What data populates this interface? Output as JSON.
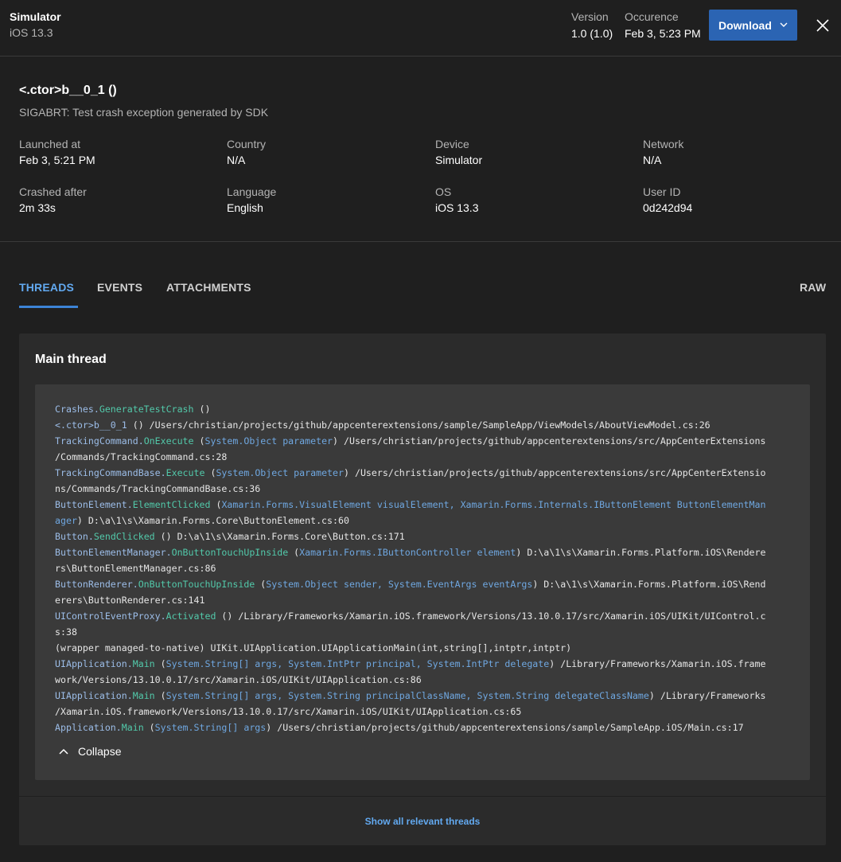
{
  "header": {
    "device_name": "Simulator",
    "device_os": "iOS 13.3",
    "version_label": "Version",
    "version_value": "1.0 (1.0)",
    "occurrence_label": "Occurence",
    "occurrence_value": "Feb 3, 5:23 PM",
    "download_label": "Download"
  },
  "crash": {
    "title": "<.ctor>b__0_1 ()",
    "reason": "SIGABRT: Test crash exception generated by SDK"
  },
  "details": {
    "launched_at_label": "Launched at",
    "launched_at_value": "Feb 3, 5:21 PM",
    "country_label": "Country",
    "country_value": "N/A",
    "device_label": "Device",
    "device_value": "Simulator",
    "network_label": "Network",
    "network_value": "N/A",
    "crashed_after_label": "Crashed after",
    "crashed_after_value": "2m 33s",
    "language_label": "Language",
    "language_value": "English",
    "os_label": "OS",
    "os_value": "iOS 13.3",
    "user_id_label": "User ID",
    "user_id_value": "0d242d94"
  },
  "tabs": {
    "threads": "THREADS",
    "events": "EVENTS",
    "attachments": "ATTACHMENTS",
    "raw": "RAW"
  },
  "thread": {
    "title": "Main thread",
    "collapse_label": "Collapse",
    "show_all_label": "Show all relevant threads",
    "lines": [
      [
        [
          "cls",
          "Crashes."
        ],
        [
          "mth",
          "GenerateTestCrash"
        ],
        [
          "txt",
          " ()"
        ]
      ],
      [
        [
          "cls",
          "<.ctor>b__0_1"
        ],
        [
          "txt",
          " () /Users/christian/projects/github/appcenterextensions/sample/SampleApp/ViewModels/AboutViewModel.cs:26"
        ]
      ],
      [
        [
          "cls",
          "TrackingCommand."
        ],
        [
          "mth",
          "OnExecute"
        ],
        [
          "txt",
          " ("
        ],
        [
          "par",
          "System.Object parameter"
        ],
        [
          "txt",
          ") /Users/christian/projects/github/appcenterextensions/src/AppCenterExtensions"
        ]
      ],
      [
        [
          "txt",
          "/Commands/TrackingCommand.cs:28"
        ]
      ],
      [
        [
          "cls",
          "TrackingCommandBase."
        ],
        [
          "mth",
          "Execute"
        ],
        [
          "txt",
          " ("
        ],
        [
          "par",
          "System.Object parameter"
        ],
        [
          "txt",
          ") /Users/christian/projects/github/appcenterextensions/src/AppCenterExtensio"
        ]
      ],
      [
        [
          "txt",
          "ns/Commands/TrackingCommandBase.cs:36"
        ]
      ],
      [
        [
          "cls",
          "ButtonElement."
        ],
        [
          "mth",
          "ElementClicked"
        ],
        [
          "txt",
          " ("
        ],
        [
          "par",
          "Xamarin.Forms.VisualElement visualElement, Xamarin.Forms.Internals.IButtonElement ButtonElementMan"
        ]
      ],
      [
        [
          "par",
          "ager"
        ],
        [
          "txt",
          ") D:\\a\\1\\s\\Xamarin.Forms.Core\\ButtonElement.cs:60"
        ]
      ],
      [
        [
          "cls",
          "Button."
        ],
        [
          "mth",
          "SendClicked"
        ],
        [
          "txt",
          " () D:\\a\\1\\s\\Xamarin.Forms.Core\\Button.cs:171"
        ]
      ],
      [
        [
          "cls",
          "ButtonElementManager."
        ],
        [
          "mth",
          "OnButtonTouchUpInside"
        ],
        [
          "txt",
          " ("
        ],
        [
          "par",
          "Xamarin.Forms.IButtonController element"
        ],
        [
          "txt",
          ") D:\\a\\1\\s\\Xamarin.Forms.Platform.iOS\\Rendere"
        ]
      ],
      [
        [
          "txt",
          "rs\\ButtonElementManager.cs:86"
        ]
      ],
      [
        [
          "cls",
          "ButtonRenderer."
        ],
        [
          "mth",
          "OnButtonTouchUpInside"
        ],
        [
          "txt",
          " ("
        ],
        [
          "par",
          "System.Object sender, System.EventArgs eventArgs"
        ],
        [
          "txt",
          ") D:\\a\\1\\s\\Xamarin.Forms.Platform.iOS\\Rend"
        ]
      ],
      [
        [
          "txt",
          "erers\\ButtonRenderer.cs:141"
        ]
      ],
      [
        [
          "cls",
          "UIControlEventProxy."
        ],
        [
          "mth",
          "Activated"
        ],
        [
          "txt",
          " () /Library/Frameworks/Xamarin.iOS.framework/Versions/13.10.0.17/src/Xamarin.iOS/UIKit/UIControl.c"
        ]
      ],
      [
        [
          "txt",
          "s:38"
        ]
      ],
      [
        [
          "txt",
          "(wrapper managed-to-native) UIKit.UIApplication.UIApplicationMain(int,string[],intptr,intptr)"
        ]
      ],
      [
        [
          "cls",
          "UIApplication."
        ],
        [
          "mth",
          "Main"
        ],
        [
          "txt",
          " ("
        ],
        [
          "par",
          "System.String[] args, System.IntPtr principal, System.IntPtr delegate"
        ],
        [
          "txt",
          ") /Library/Frameworks/Xamarin.iOS.frame"
        ]
      ],
      [
        [
          "txt",
          "work/Versions/13.10.0.17/src/Xamarin.iOS/UIKit/UIApplication.cs:86"
        ]
      ],
      [
        [
          "cls",
          "UIApplication."
        ],
        [
          "mth",
          "Main"
        ],
        [
          "txt",
          " ("
        ],
        [
          "par",
          "System.String[] args, System.String principalClassName, System.String delegateClassName"
        ],
        [
          "txt",
          ") /Library/Frameworks"
        ]
      ],
      [
        [
          "txt",
          "/Xamarin.iOS.framework/Versions/13.10.0.17/src/Xamarin.iOS/UIKit/UIApplication.cs:65"
        ]
      ],
      [
        [
          "cls",
          "Application."
        ],
        [
          "mth",
          "Main"
        ],
        [
          "txt",
          " ("
        ],
        [
          "par",
          "System.String[] args"
        ],
        [
          "txt",
          ") /Users/christian/projects/github/appcenterextensions/sample/SampleApp.iOS/Main.cs:17"
        ]
      ]
    ]
  },
  "colors": {
    "background": "#1f1f1f",
    "accent": "#2b64b3",
    "link": "#62a9f0",
    "class_name": "#9cbde8",
    "method_name": "#52c9aa",
    "parameters": "#6fa7e0"
  },
  "icons": [
    "chevron-down-icon",
    "close-icon",
    "chevron-up-icon"
  ]
}
